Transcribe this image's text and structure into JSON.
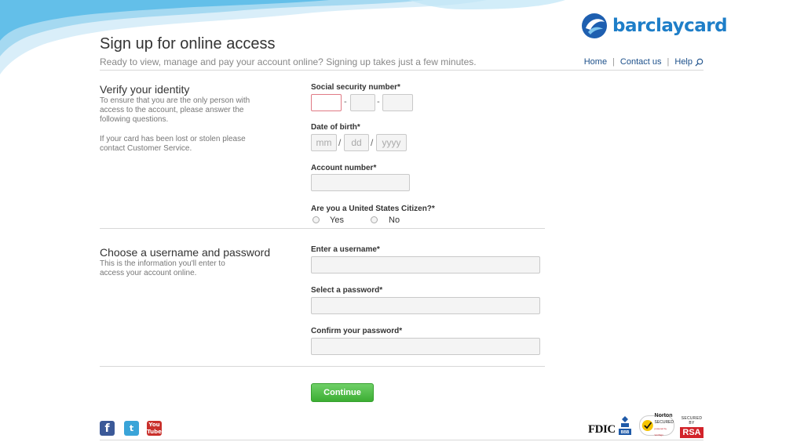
{
  "brand": {
    "logo_text": "barclaycard",
    "color": "#1e7ec8"
  },
  "header": {
    "title": "Sign up for online access",
    "subtitle": "Ready to view, manage and pay your account online? Signing up takes just a few minutes."
  },
  "nav": {
    "home": "Home",
    "contact": "Contact us",
    "help": "Help",
    "separator": "|",
    "help_icon": "search-icon"
  },
  "verify": {
    "heading": "Verify your identity",
    "desc": "To ensure that you are the only person with access to the account, please answer the following questions.",
    "lost_note": "If your card has been lost or stolen please contact Customer Service.",
    "ssn_label": "Social security number*",
    "ssn_sep": "-",
    "dob_label": "Date of birth*",
    "dob_placeholders": {
      "month": "mm",
      "day": "dd",
      "year": "yyyy"
    },
    "dob_sep": "/",
    "account_label": "Account number*",
    "citizen_label": "Are you a United States Citizen?*",
    "citizen_options": {
      "yes": "Yes",
      "no": "No"
    }
  },
  "credentials": {
    "heading": "Choose a username and password",
    "desc": "This is the information you'll enter to access your account online.",
    "username_label": "Enter a username*",
    "password_label": "Select a password*",
    "confirm_label": "Confirm your password*"
  },
  "actions": {
    "continue": "Continue"
  },
  "footer": {
    "social": {
      "facebook": "f",
      "twitter": "t",
      "youtube_top": "You",
      "youtube_bottom": "Tube"
    },
    "badges": {
      "fdic": "FDIC",
      "bbb": "BBB",
      "norton_title": "Norton",
      "norton_sub": "SECURED",
      "norton_powered": "powered by VeriSign",
      "rsa_small": "SECURED BY",
      "rsa": "RSA"
    }
  },
  "colors": {
    "error_border": "#e07a85",
    "button_green": "#3cae33",
    "link_blue": "#1b4f8a"
  }
}
